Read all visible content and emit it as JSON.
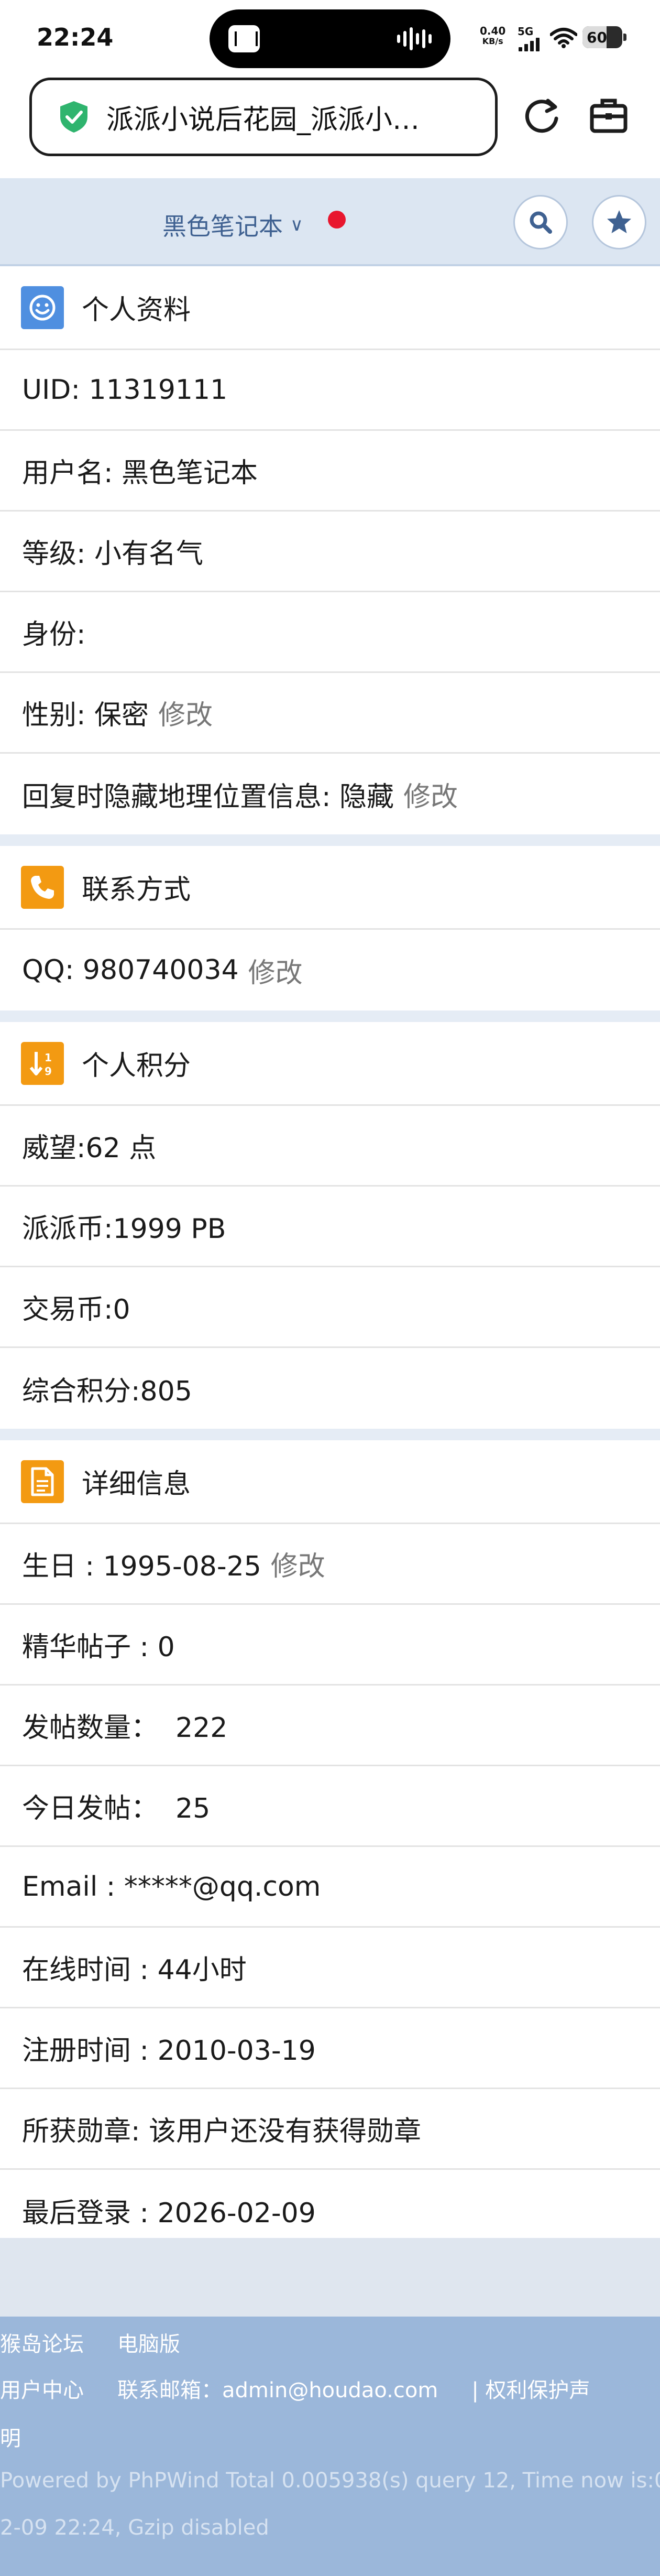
{
  "status_bar": {
    "time": "22:24",
    "net_speed_value": "0.40",
    "net_speed_unit": "KB/s",
    "network": "5G",
    "battery": "60"
  },
  "browser": {
    "url_title": "派派小说后花园_派派小…"
  },
  "header": {
    "username": "黑色笔记本"
  },
  "sections": {
    "profile": {
      "title": "个人资料",
      "uid": "UID: 11319111",
      "username": "用户名: 黑色笔记本",
      "level": "等级: 小有名气",
      "identity": "身份:",
      "gender": "性别: 保密",
      "location_privacy": "回复时隐藏地理位置信息: 隐藏"
    },
    "contact": {
      "title": "联系方式",
      "qq": "QQ: 980740034"
    },
    "points": {
      "title": "个人积分",
      "prestige": "威望:62 点",
      "paipai_coin": "派派币:1999 PB",
      "trade_coin": "交易币:0",
      "total": "综合积分:805"
    },
    "details": {
      "title": "详细信息",
      "birthday": "生日 : 1995-08-25",
      "digest_posts": "精华帖子 : 0",
      "post_count": "发帖数量：  222",
      "today_posts": "今日发帖：  25",
      "email": "Email : *****@qq.com",
      "online_time": "在线时间 : 44小时",
      "register_time": "注册时间 : 2010-03-19",
      "medals": "所获勋章: 该用户还没有获得勋章",
      "last_login": "最后登录 : 2026-02-09"
    },
    "edit_label": "修改"
  },
  "footer": {
    "forum_link": "猴岛论坛",
    "pc_version_link": "电脑版",
    "user_center_link": "用户中心",
    "contact_email": "联系邮箱：admin@houdao.com",
    "rights_link": "| 权利保护声",
    "rights_link_wrap": "明",
    "powered_line1": "Powered by PhPWind Total 0.005938(s) query 12, Time now is:0",
    "powered_line2": "2-09 22:24, Gzip disabled"
  }
}
